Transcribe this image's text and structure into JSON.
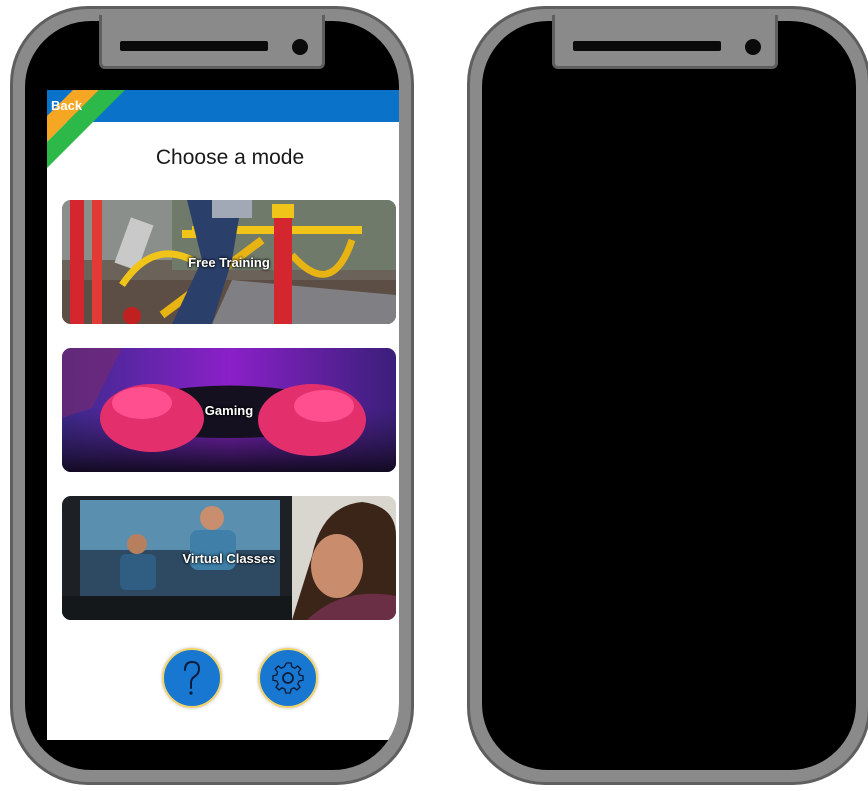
{
  "app": {
    "back_label": "Back",
    "title": "Choose a mode"
  },
  "modes": [
    {
      "label": "Free Training"
    },
    {
      "label": "Gaming"
    },
    {
      "label": "Virtual Classes"
    }
  ],
  "buttons": {
    "help_icon": "question-mark-icon",
    "settings_icon": "gear-icon"
  },
  "colors": {
    "topbar": "#0a73c9",
    "button_fill": "#1877d1",
    "button_ring": "#f2d46b",
    "stripe_yellow": "#f5a623",
    "stripe_green": "#2db84a",
    "phone_frame": "#8a8a8a"
  }
}
